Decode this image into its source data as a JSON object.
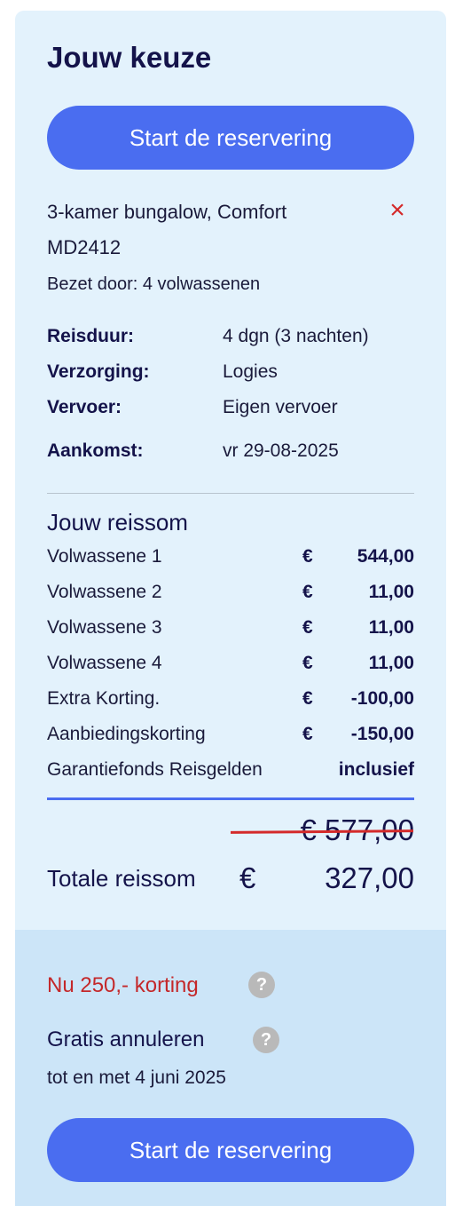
{
  "header": {
    "title": "Jouw keuze"
  },
  "buttons": {
    "start_top": "Start de reservering",
    "start_bottom": "Start de reservering"
  },
  "accommodation": {
    "name": "3-kamer bungalow, Comfort",
    "code": "MD2412",
    "occupancy": "Bezet door: 4 volwassenen",
    "remove_icon": "close-icon"
  },
  "details": [
    {
      "label": "Reisduur:",
      "value": "4 dgn (3 nachten)"
    },
    {
      "label": "Verzorging:",
      "value": "Logies"
    },
    {
      "label": "Vervoer:",
      "value": "Eigen vervoer"
    },
    {
      "label": "Aankomst:",
      "value": "vr 29-08-2025"
    }
  ],
  "price": {
    "section_title": "Jouw reissom",
    "rows": [
      {
        "label": "Volwassene 1",
        "currency": "€",
        "amount": "544,00"
      },
      {
        "label": "Volwassene 2",
        "currency": "€",
        "amount": "11,00"
      },
      {
        "label": "Volwassene 3",
        "currency": "€",
        "amount": "11,00"
      },
      {
        "label": "Volwassene 4",
        "currency": "€",
        "amount": "11,00"
      },
      {
        "label": "Extra Korting.",
        "currency": "€",
        "amount": "-100,00"
      },
      {
        "label": "Aanbiedingskorting",
        "currency": "€",
        "amount": "-150,00"
      }
    ],
    "guarantee": {
      "label": "Garantiefonds Reisgelden",
      "value": "inclusief"
    },
    "old_total": "€ 577,00",
    "total_label": "Totale reissom",
    "total_currency": "€",
    "total_amount": "327,00"
  },
  "promo": {
    "discount_text": "Nu 250,- korting",
    "cancel_title": "Gratis annuleren",
    "cancel_until": "tot en met 4 juni 2025",
    "help_glyph": "?"
  },
  "colors": {
    "accent": "#4a6df0",
    "discount": "#c4282a",
    "panel": "#e3f2fc",
    "panel_bottom": "#cce5f8"
  }
}
